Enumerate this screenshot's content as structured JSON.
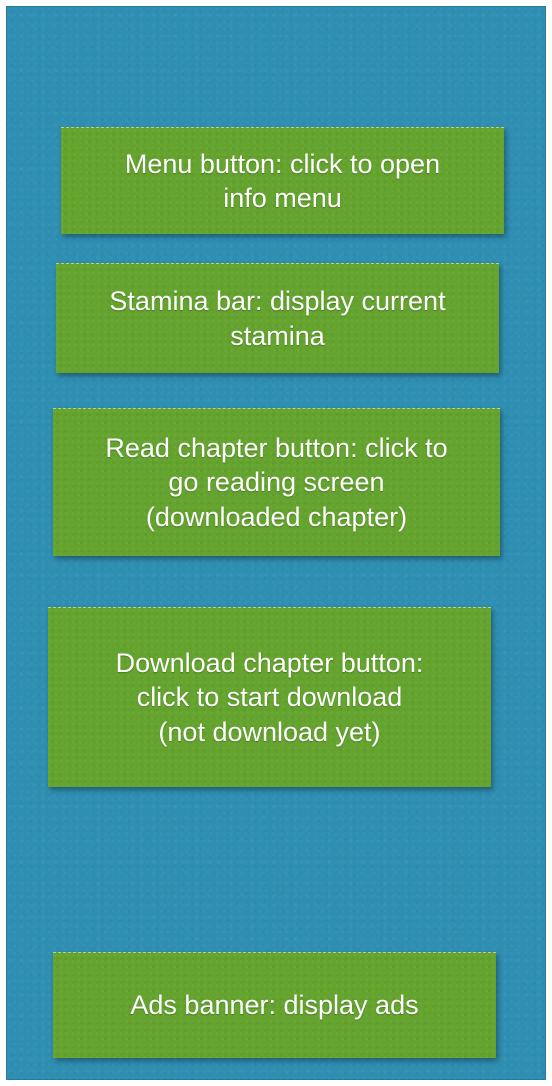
{
  "notes": [
    {
      "lines": [
        "Menu button: click to open",
        "info menu"
      ]
    },
    {
      "lines": [
        "Stamina bar: display current",
        "stamina"
      ]
    },
    {
      "lines": [
        "Read chapter button: click to",
        "go reading screen",
        "(downloaded chapter)"
      ]
    },
    {
      "lines": [
        "Download chapter button:",
        "click to start download",
        "(not download yet)"
      ]
    },
    {
      "lines": [
        "Ads banner: display ads"
      ]
    }
  ],
  "colors": {
    "background": "#2f8fb2",
    "note": "#64a32e",
    "text": "#ffffff"
  }
}
